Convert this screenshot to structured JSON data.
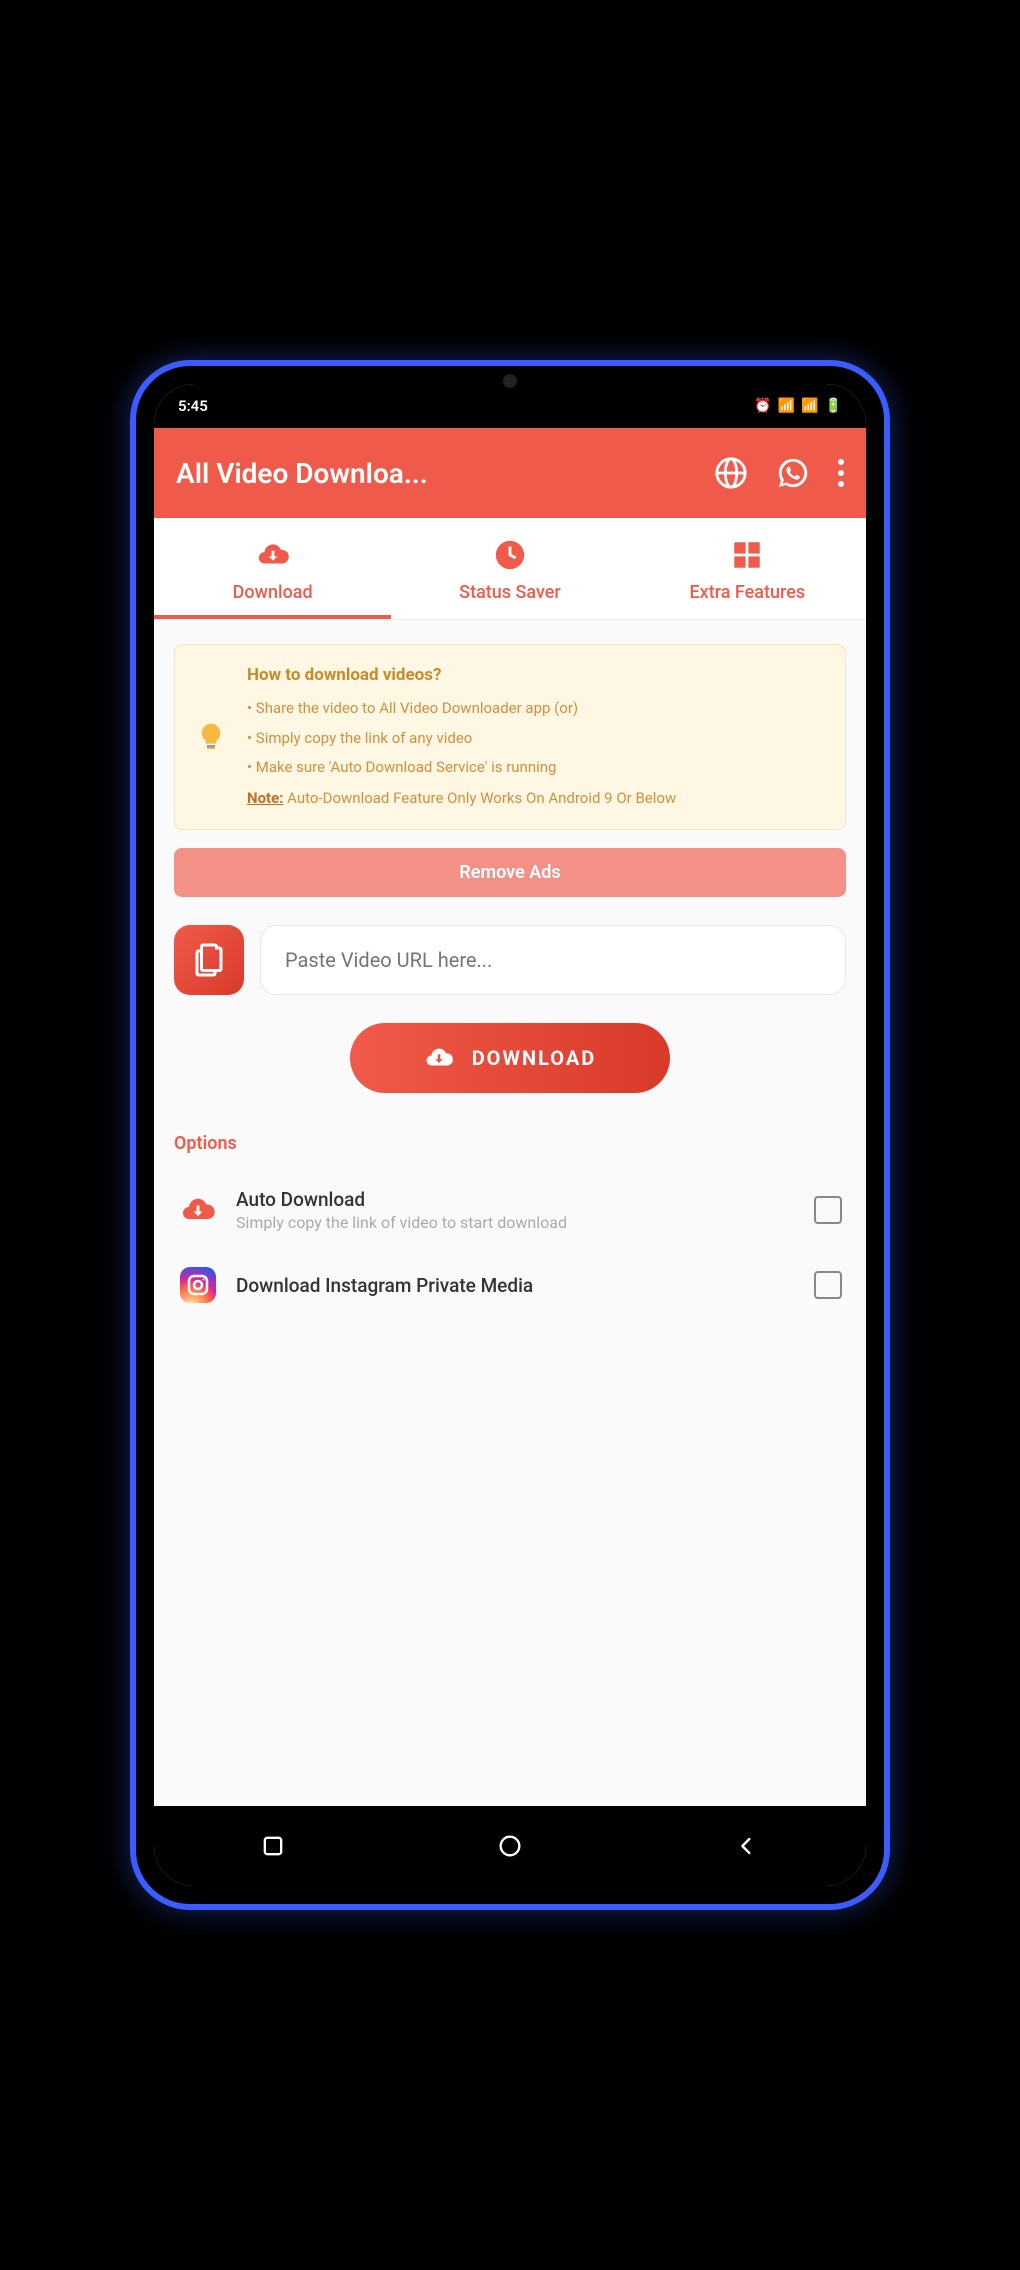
{
  "status": {
    "time": "5:45"
  },
  "appbar": {
    "title": "All Video Downloa..."
  },
  "tabs": [
    {
      "label": "Download"
    },
    {
      "label": "Status Saver"
    },
    {
      "label": "Extra Features"
    }
  ],
  "info": {
    "title": "How to download videos?",
    "line1": "• Share the video to All Video Downloader app (or)",
    "line2": "• Simply copy the link of any video",
    "line3": "• Make sure 'Auto Download Service' is running",
    "note_prefix": "Note:",
    "note_text": " Auto-Download Feature Only Works On Android 9 Or Below"
  },
  "remove_ads": "Remove Ads",
  "url_placeholder": "Paste Video URL here...",
  "download_btn": "DOWNLOAD",
  "options_label": "Options",
  "options": [
    {
      "title": "Auto Download",
      "subtitle": "Simply copy the link of video to start download"
    },
    {
      "title": "Download Instagram Private Media",
      "subtitle": ""
    }
  ]
}
